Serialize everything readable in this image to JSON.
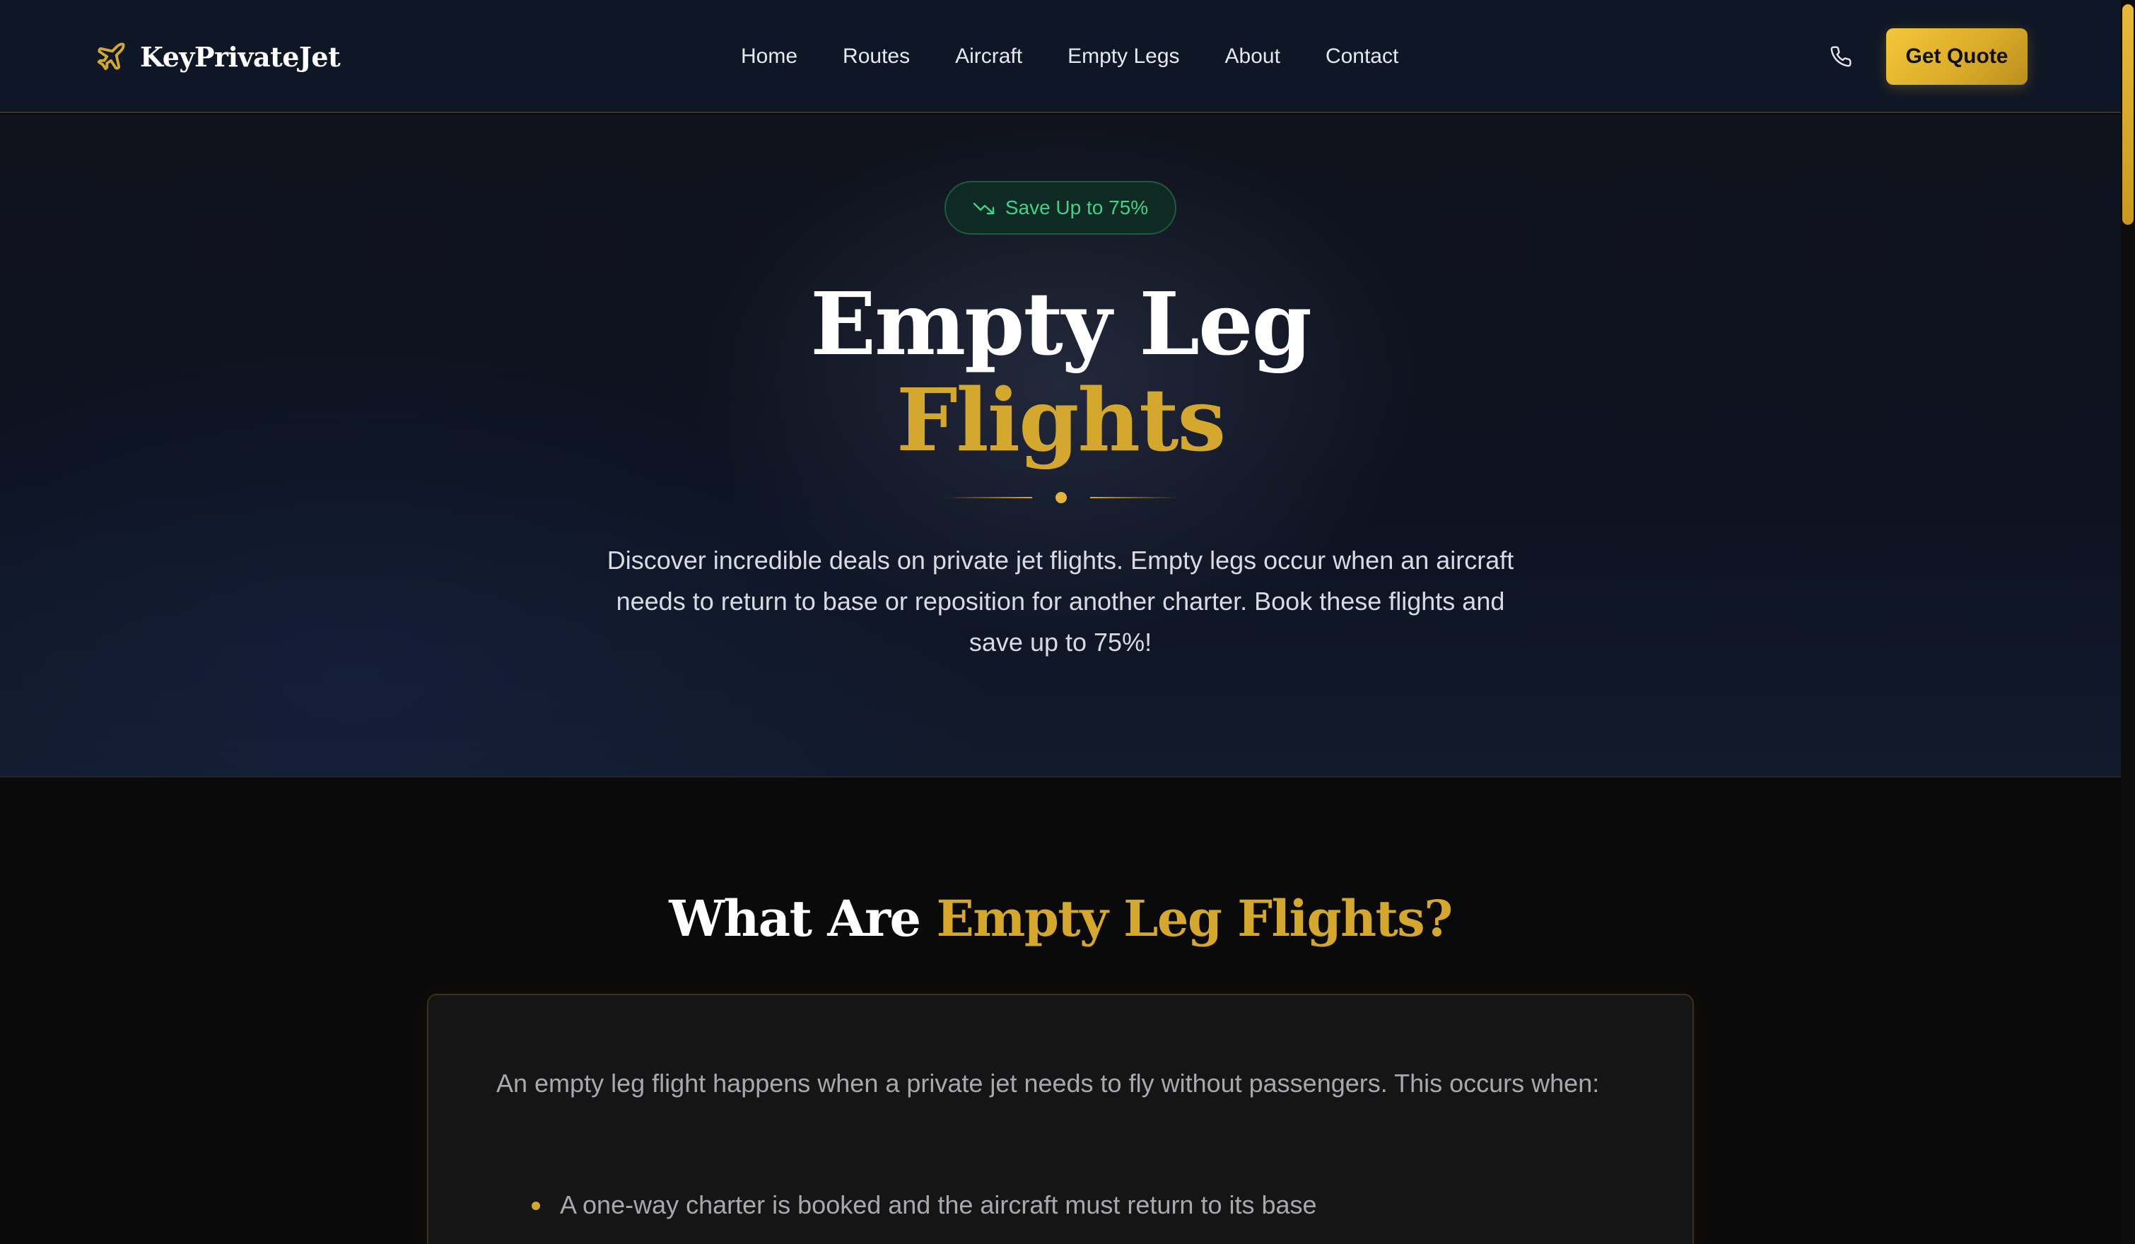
{
  "brand": {
    "name": "KeyPrivateJet",
    "icon": "plane-icon",
    "color": "#d4a72e"
  },
  "nav": {
    "links": [
      "Home",
      "Routes",
      "Aircraft",
      "Empty Legs",
      "About",
      "Contact"
    ],
    "phone_icon": "phone-icon",
    "cta_label": "Get Quote"
  },
  "hero": {
    "badge": {
      "icon": "trending-down-icon",
      "label": "Save Up to 75%",
      "color": "#3fd38a"
    },
    "title_line1": "Empty Leg",
    "title_line2": "Flights",
    "description": "Discover incredible deals on private jet flights. Empty legs occur when an aircraft needs to return to base or reposition for another charter. Book these flights and save up to 75%!"
  },
  "section": {
    "title_plain": "What Are ",
    "title_accent": "Empty Leg Flights?",
    "intro": "An empty leg flight happens when a private jet needs to fly without passengers. This occurs when:",
    "items": [
      "A one-way charter is booked and the aircraft must return to its base"
    ]
  },
  "colors": {
    "accent": "#d4a72e",
    "background": "#0a0a0a",
    "nav_background": "#0f1626"
  }
}
